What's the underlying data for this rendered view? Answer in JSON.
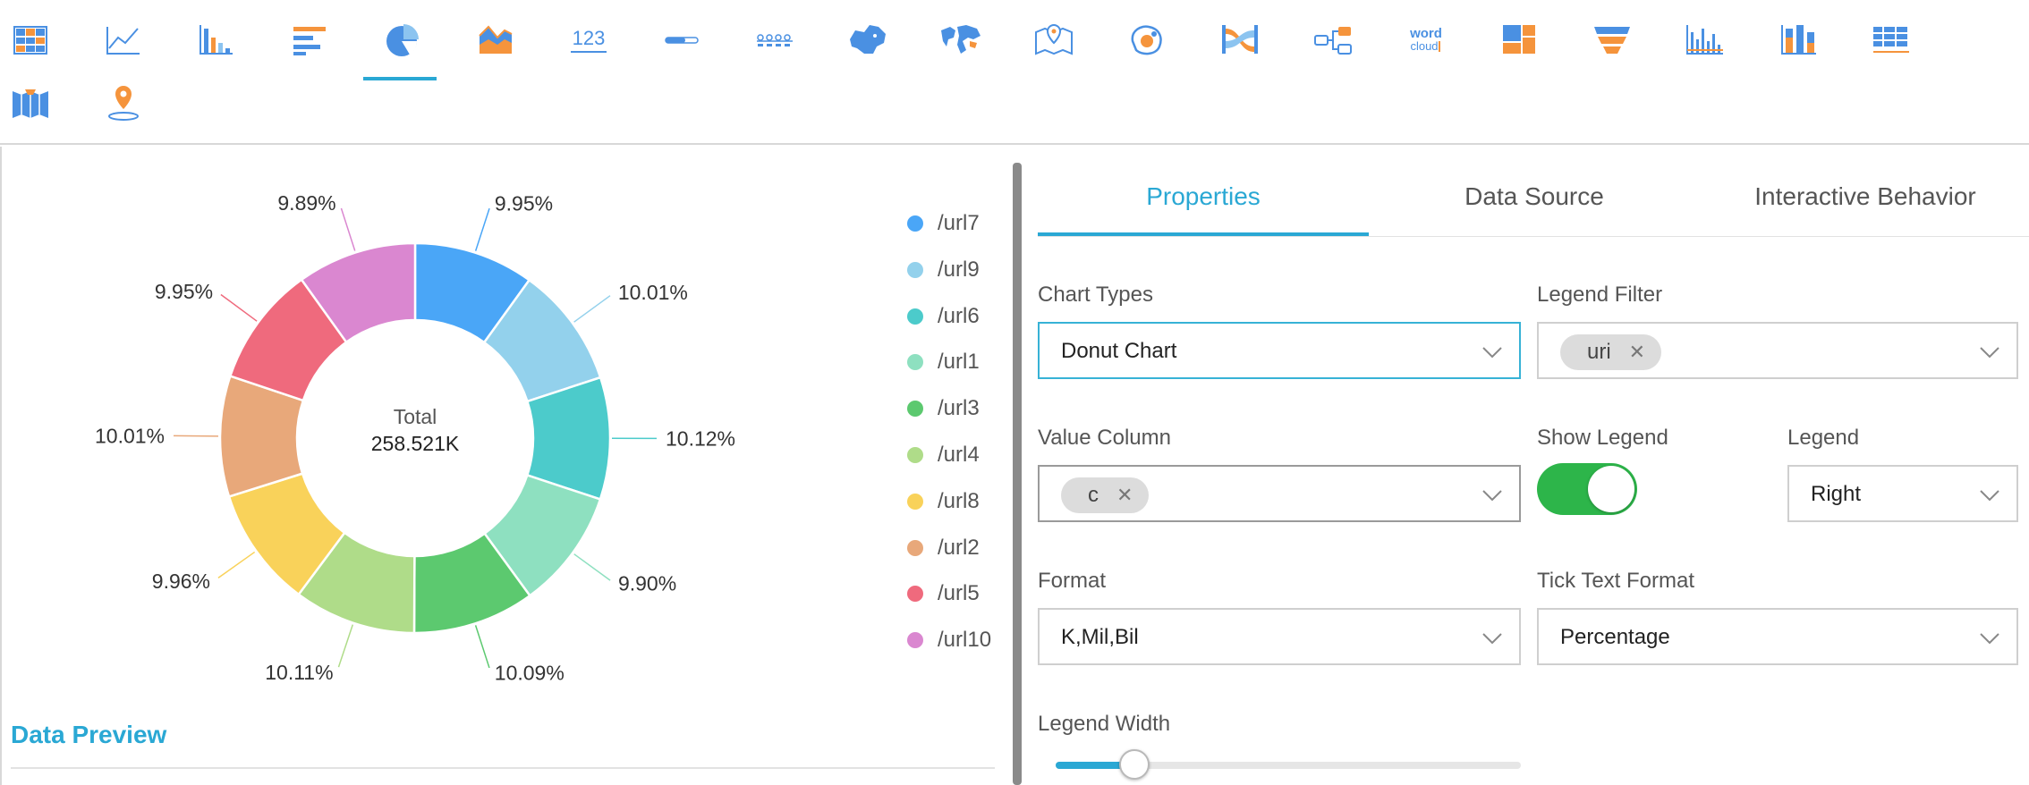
{
  "toolbar": {
    "icons": [
      {
        "name": "table-chart-icon",
        "row": 0
      },
      {
        "name": "line-chart-icon",
        "row": 0
      },
      {
        "name": "bar-chart-icon",
        "row": 0
      },
      {
        "name": "horizontal-bar-chart-icon",
        "row": 0
      },
      {
        "name": "pie-chart-icon",
        "row": 0,
        "active": true
      },
      {
        "name": "area-chart-icon",
        "row": 0
      },
      {
        "name": "kpi-number-icon",
        "row": 0,
        "text": "123"
      },
      {
        "name": "progress-bar-icon",
        "row": 0
      },
      {
        "name": "timeline-icon",
        "row": 0
      },
      {
        "name": "china-map-icon",
        "row": 0
      },
      {
        "name": "world-map-icon",
        "row": 0
      },
      {
        "name": "location-map-icon",
        "row": 0
      },
      {
        "name": "bubble-map-icon",
        "row": 0
      },
      {
        "name": "sankey-chart-icon",
        "row": 0
      },
      {
        "name": "flow-diagram-icon",
        "row": 0
      },
      {
        "name": "word-cloud-icon",
        "row": 0,
        "text_top": "word",
        "text_bottom": "cloud"
      },
      {
        "name": "treemap-icon",
        "row": 0
      },
      {
        "name": "funnel-chart-icon",
        "row": 0
      },
      {
        "name": "histogram-icon",
        "row": 0
      },
      {
        "name": "stacked-column-icon",
        "row": 0
      },
      {
        "name": "pivot-table-icon",
        "row": 0
      },
      {
        "name": "region-map-icon",
        "row": 1
      },
      {
        "name": "point-map-icon",
        "row": 1
      }
    ]
  },
  "chart_data": {
    "type": "pie",
    "variant": "donut",
    "center_label": "Total",
    "center_value": "258.521K",
    "categories": [
      "/url7",
      "/url9",
      "/url6",
      "/url1",
      "/url3",
      "/url4",
      "/url8",
      "/url2",
      "/url5",
      "/url10"
    ],
    "values": [
      9.95,
      10.01,
      10.12,
      9.9,
      10.09,
      10.11,
      9.96,
      10.01,
      9.95,
      9.89
    ],
    "labels": [
      "9.95%",
      "10.01%",
      "10.12%",
      "9.90%",
      "10.09%",
      "10.11%",
      "9.96%",
      "10.01%",
      "9.95%",
      "9.89%"
    ],
    "colors": [
      "#4aa6f7",
      "#93d1ec",
      "#4ccbcb",
      "#8ee0c0",
      "#5cc96f",
      "#afdc89",
      "#f9d25a",
      "#e8a87a",
      "#ef6a7d",
      "#da87d0"
    ],
    "legend_position": "right"
  },
  "chart_panel": {
    "data_preview_label": "Data Preview"
  },
  "properties": {
    "tabs": [
      {
        "label": "Properties",
        "active": true
      },
      {
        "label": "Data Source",
        "active": false
      },
      {
        "label": "Interactive Behavior",
        "active": false
      }
    ],
    "chart_types": {
      "label": "Chart Types",
      "value": "Donut Chart"
    },
    "legend_filter": {
      "label": "Legend Filter",
      "chip": "uri"
    },
    "value_column": {
      "label": "Value Column",
      "chip": "c"
    },
    "show_legend": {
      "label": "Show Legend",
      "on": true
    },
    "legend": {
      "label": "Legend",
      "value": "Right"
    },
    "format": {
      "label": "Format",
      "value": "K,Mil,Bil"
    },
    "tick_text_format": {
      "label": "Tick Text Format",
      "value": "Percentage"
    },
    "legend_width": {
      "label": "Legend Width",
      "fraction": 0.17
    },
    "accent_color": "#2aa8d4",
    "toggle_color": "#2db54a"
  }
}
